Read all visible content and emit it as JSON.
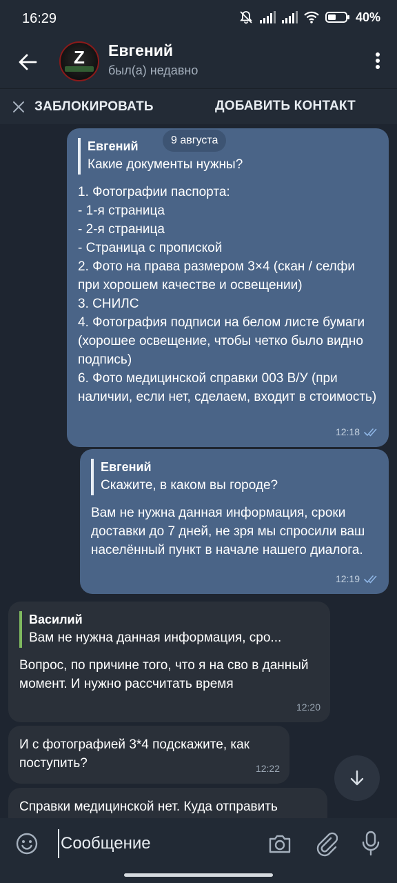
{
  "status_bar": {
    "time": "16:29",
    "battery": "40%"
  },
  "header": {
    "name": "Евгений",
    "subtitle": "был(а) недавно",
    "avatar_letter": "Z"
  },
  "action_bar": {
    "block_label": "ЗАБЛОКИРОВАТЬ",
    "add_contact_label": "ДОБАВИТЬ КОНТАКТ"
  },
  "chat": {
    "date_label": "9 августа",
    "messages": [
      {
        "direction": "out",
        "reply_name": "Евгений",
        "reply_text": "Какие документы нужны?",
        "text": "1. Фотографии паспорта:\n- 1-я страница\n- 2-я страница\n- Страница с пропиской\n2. Фото на права размером 3×4 (скан / селфи при хорошем качестве и освещении)\n3. СНИЛС\n4. Фотография подписи на белом листе бумаги (хорошее освещение, чтобы четко было видно подпись)\n6. Фото медицинской справки 003 В/У (при наличии, если нет, сделаем, входит в стоимость)",
        "time": "12:18",
        "read": true
      },
      {
        "direction": "out",
        "reply_name": "Евгений",
        "reply_text": "Скажите, в каком вы городе?",
        "text": "Вам не нужна данная информация, сроки доставки до 7 дней, не зря мы спросили ваш населённый пункт в начале нашего диалога.",
        "time": "12:19",
        "read": true
      },
      {
        "direction": "in",
        "reply_name": "Василий",
        "reply_text": "Вам не нужна данная информация, сро...",
        "text": "Вопрос, по причине того, что я на сво в данный момент. И нужно рассчитать время",
        "time": "12:20"
      },
      {
        "direction": "in",
        "text": "И с фотографией 3*4 подскажите, как поступить?",
        "time": "12:22"
      },
      {
        "direction": "in",
        "text": "Справки медицинской нет. Куда отправить"
      }
    ]
  },
  "input": {
    "placeholder": "Сообщение"
  },
  "colors": {
    "background": "#1e2530",
    "outgoing_bubble": "#4a6487",
    "incoming_bubble": "#2a3039",
    "reply_accent_incoming": "#7fb95f"
  }
}
